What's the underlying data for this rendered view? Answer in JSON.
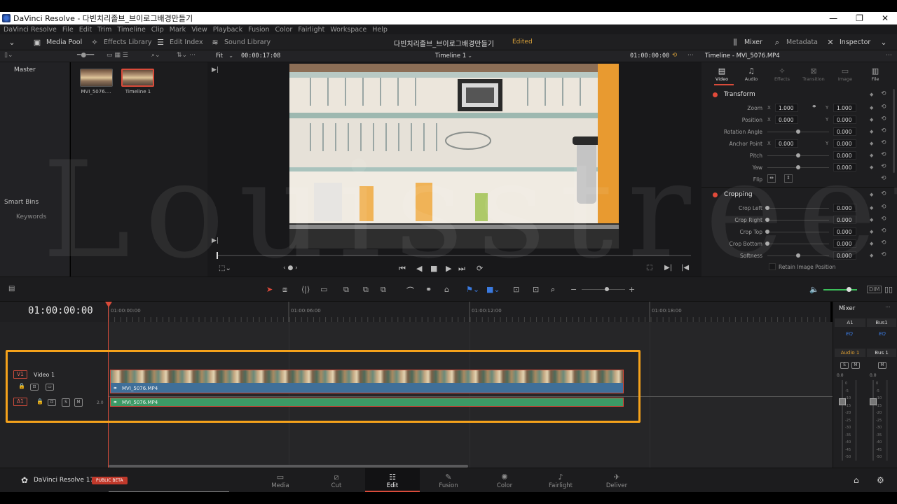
{
  "titlebar": {
    "title": "DaVinci Resolve - 다빈치리졸브_브이로그배경만들기",
    "min": "—",
    "max": "❐",
    "close": "✕"
  },
  "menu": [
    "DaVinci Resolve",
    "File",
    "Edit",
    "Trim",
    "Timeline",
    "Clip",
    "Mark",
    "View",
    "Playback",
    "Fusion",
    "Color",
    "Fairlight",
    "Workspace",
    "Help"
  ],
  "toolbar": {
    "media_pool": "Media Pool",
    "effects_library": "Effects Library",
    "edit_index": "Edit Index",
    "sound_library": "Sound Library",
    "project_title": "다빈치리졸브_브이로그배경만들기",
    "edited": "Edited",
    "mixer": "Mixer",
    "metadata": "Metadata",
    "inspector": "Inspector"
  },
  "media_pool": {
    "master": "Master",
    "smart_bins": "Smart Bins",
    "keywords": "Keywords",
    "clips": [
      {
        "label": "MVI_5076...."
      },
      {
        "label": "Timeline 1"
      }
    ]
  },
  "viewer": {
    "fit": "Fit",
    "timecode": "00:00:17:08",
    "timeline_name": "Timeline 1",
    "right_timecode": "01:00:00:00"
  },
  "inspector": {
    "title": "Timeline - MVI_5076.MP4",
    "tabs": [
      "Video",
      "Audio",
      "Effects",
      "Transition",
      "Image",
      "File"
    ],
    "transform": {
      "title": "Transform",
      "zoom": {
        "label": "Zoom",
        "x": "1.000",
        "y": "1.000"
      },
      "position": {
        "label": "Position",
        "x": "0.000",
        "y": "0.000"
      },
      "rotation": {
        "label": "Rotation Angle",
        "value": "0.000"
      },
      "anchor": {
        "label": "Anchor Point",
        "x": "0.000",
        "y": "0.000"
      },
      "pitch": {
        "label": "Pitch",
        "value": "0.000"
      },
      "yaw": {
        "label": "Yaw",
        "value": "0.000"
      },
      "flip": {
        "label": "Flip"
      }
    },
    "cropping": {
      "title": "Cropping",
      "crop_left": {
        "label": "Crop Left",
        "value": "0.000"
      },
      "crop_right": {
        "label": "Crop Right",
        "value": "0.000"
      },
      "crop_top": {
        "label": "Crop Top",
        "value": "0.000"
      },
      "crop_bottom": {
        "label": "Crop Bottom",
        "value": "0.000"
      },
      "softness": {
        "label": "Softness",
        "value": "0.000"
      },
      "retain": "Retain Image Position"
    }
  },
  "timeline": {
    "timecode": "01:00:00:00",
    "ruler": [
      "01:00:00:00",
      "01:00:06:00",
      "01:00:12:00",
      "01:00:18:00"
    ],
    "video_track": {
      "badge": "V1",
      "name": "Video 1",
      "clip": "MVI_5076.MP4"
    },
    "audio_track": {
      "badge": "A1",
      "level": "2.0",
      "clip": "MVI_5076.MP4",
      "s": "S",
      "m": "M"
    }
  },
  "mixer": {
    "title": "Mixer",
    "a1": "A1",
    "bus1": "Bus1",
    "eq": "EQ",
    "audio1": "Audio 1",
    "bus1b": "Bus 1",
    "s": "S",
    "m": "M",
    "meter_top": "0.0",
    "scale": [
      "0",
      "-5",
      "-10",
      "-15",
      "-20",
      "-25",
      "-30",
      "-35",
      "-40",
      "-45",
      "-50"
    ]
  },
  "pages": [
    "Media",
    "Cut",
    "Edit",
    "Fusion",
    "Color",
    "Fairlight",
    "Deliver"
  ],
  "brand": {
    "name": "DaVinci Resolve 17",
    "beta": "PUBLIC BETA"
  },
  "watermark": "Louisstreet",
  "colors": {
    "accent": "#d94b3a",
    "highlight": "#f5a21b",
    "edited": "#d9a23a"
  }
}
